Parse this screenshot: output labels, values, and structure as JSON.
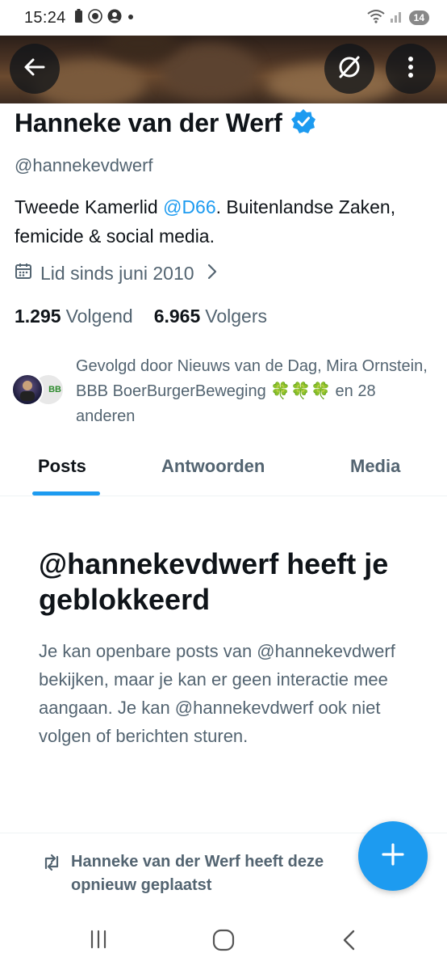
{
  "status_bar": {
    "time": "15:24",
    "badge": "14"
  },
  "header": {
    "back_icon": "arrow-left-icon",
    "grok_icon": "grok-slash-icon",
    "more_icon": "more-vertical-icon"
  },
  "profile": {
    "name": "Hanneke van der Werf",
    "handle": "@hannekevdwerf",
    "bio_prefix": "Tweede Kamerlid ",
    "bio_mention": "@D66",
    "bio_suffix": ". Buitenlandse Zaken, femicide & social media.",
    "joined": "Lid sinds juni 2010",
    "following_count": "1.295",
    "following_label": "Volgend",
    "followers_count": "6.965",
    "followers_label": "Volgers",
    "followed_by_prefix": "Gevolgd door Nieuws van de Dag, Mira Ornstein, BBB BoerBurgerBeweging ",
    "followed_by_emoji": "🍀🍀🍀",
    "followed_by_suffix": " en 28 anderen",
    "avatar_2_text": "BB"
  },
  "tabs": [
    {
      "label": "Posts",
      "active": true
    },
    {
      "label": "Antwoorden",
      "active": false
    },
    {
      "label": "Media",
      "active": false
    }
  ],
  "blocked": {
    "title": "@hannekevdwerf heeft je geblokkeerd",
    "body": "Je kan openbare posts van @hannekevdwerf bekijken, maar je kan er geen interactie mee aangaan. Je kan @hannekevdwerf ook niet volgen of berichten sturen."
  },
  "repost": {
    "text": "Hanneke van der Werf heeft deze opnieuw geplaatst"
  },
  "colors": {
    "accent": "#1d9bf0",
    "text_primary": "#0f1419",
    "text_secondary": "#536471",
    "verified": "#1d9bf0"
  }
}
